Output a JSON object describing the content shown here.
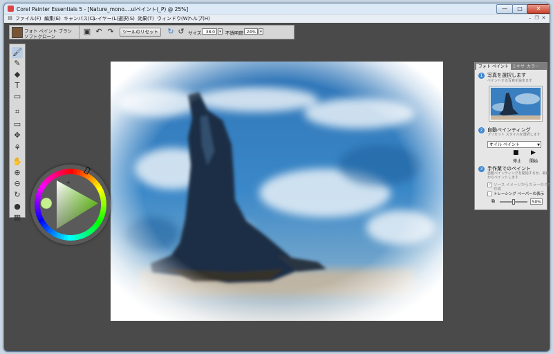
{
  "window": {
    "title": "Corel Painter Essentials 5 - [Nature_mono....ulペイント(_P) @ 25%]",
    "minimize": "—",
    "maximize": "□",
    "close": "✕"
  },
  "menu": [
    {
      "label": "ファイル(F)"
    },
    {
      "label": "編集(E)"
    },
    {
      "label": "キャンバス(C)"
    },
    {
      "label": "レイヤー(L)"
    },
    {
      "label": "選択(S)"
    },
    {
      "label": "効果(T)"
    },
    {
      "label": "ウィンドウ(W)"
    },
    {
      "label": "ヘルプ(H)"
    }
  ],
  "property_bar": {
    "brush_category": "フォト ペイント ブラシ",
    "brush_variant": "ソフトクローン",
    "reset_label": "ツールのリセット",
    "size_label": "サイズ:",
    "size_value": "38.0",
    "opacity_label": "不透明度:",
    "opacity_value": "24%"
  },
  "toolbox": [
    {
      "name": "brush-tool",
      "icon": "🖌"
    },
    {
      "name": "dropper-tool",
      "icon": "✎"
    },
    {
      "name": "paint-bucket-tool",
      "icon": "◆"
    },
    {
      "name": "text-tool",
      "icon": "T"
    },
    {
      "name": "eraser-tool",
      "icon": "▭"
    },
    {
      "name": "crop-tool",
      "icon": "⌗"
    },
    {
      "name": "rectangle-select-tool",
      "icon": "▭"
    },
    {
      "name": "transform-tool",
      "icon": "✥"
    },
    {
      "name": "clone-tool",
      "icon": "⚘"
    },
    {
      "name": "grabber-tool",
      "icon": "✋"
    },
    {
      "name": "zoom-in-tool",
      "icon": "⊕"
    },
    {
      "name": "zoom-out-tool",
      "icon": "⊖"
    },
    {
      "name": "rotate-tool",
      "icon": "↻"
    },
    {
      "name": "color-swatches",
      "icon": "●"
    },
    {
      "name": "texture-swatch",
      "icon": "▦"
    }
  ],
  "panel": {
    "tabs": [
      {
        "label": "フォト ペイント"
      },
      {
        "label": "ミキサ"
      },
      {
        "label": "カラー"
      }
    ],
    "step1": {
      "num": "1",
      "title": "写真を選択します",
      "desc": "ペイントする写真を設定ます"
    },
    "step2": {
      "num": "2",
      "title": "自動ペインティング",
      "desc": "プリセット スタイルを選択します",
      "preset": "オイル ペイント",
      "stop_label": "停止",
      "start_label": "開始"
    },
    "step3": {
      "num": "3",
      "title": "手作業でのペイント",
      "desc": [
        "自動ペインティングを開始するか、最初",
        "からペイントします"
      ],
      "clone_color_label": "ソース イメージからカラーのクローン",
      "clone_color_label2": "作成",
      "tracing_label": "トレーシング ペーパーの表示",
      "tracing_value_label": "50%",
      "tracing_opacity": 50
    }
  },
  "color_wheel": {
    "hue_color": "#7cdb2c",
    "selected_color": "#c5f08e"
  }
}
